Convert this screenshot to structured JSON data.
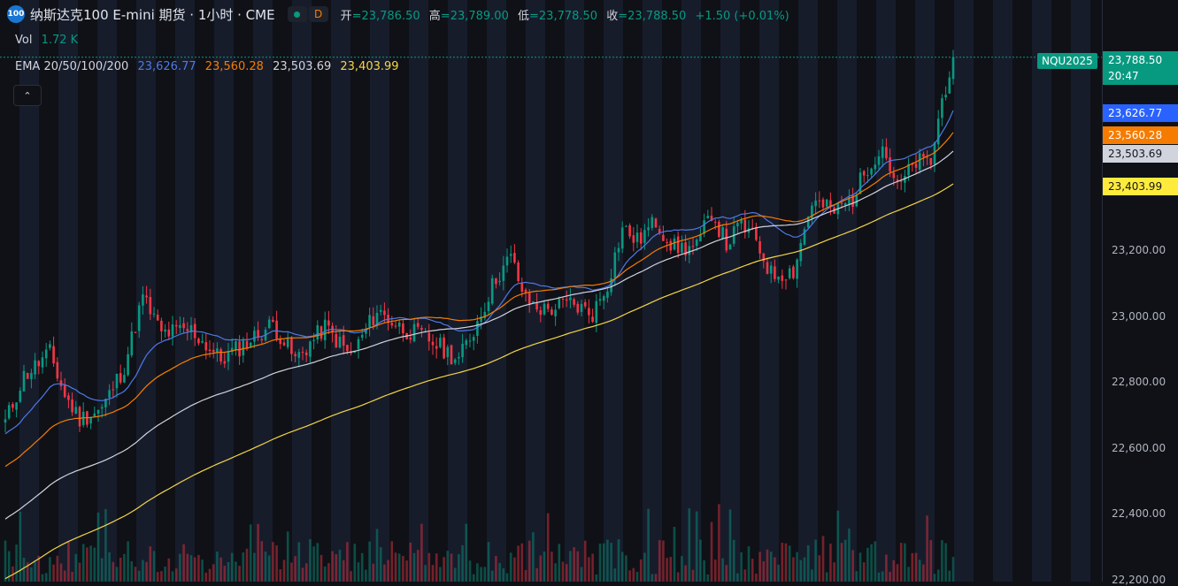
{
  "header": {
    "logo_text": "100",
    "title": "纳斯达克100 E-mini 期货 · 1小时 · CME",
    "interval_button": "D",
    "ohlc": [
      {
        "label": "开",
        "value": "=23,786.50"
      },
      {
        "label": "高",
        "value": "=23,789.00"
      },
      {
        "label": "低",
        "value": "=23,778.50"
      },
      {
        "label": "收",
        "value": "=23,788.50"
      },
      {
        "label": "",
        "value": "+1.50 (+0.01%)"
      }
    ]
  },
  "volume": {
    "label": "Vol",
    "value": "1.72 K"
  },
  "ema": {
    "label": "EMA 20/50/100/200",
    "values": [
      "23,626.77",
      "23,560.28",
      "23,503.69",
      "23,403.99"
    ],
    "colors": [
      "#4e79e6",
      "#f57c00",
      "#d1d4dc",
      "#f5d547"
    ]
  },
  "colors": {
    "up": "#089981",
    "down": "#f23645",
    "background": "#0f1117",
    "band": "#171c2b"
  },
  "symbol_tag": "NQU2025",
  "price_scale": {
    "current_price": "23,788.50",
    "countdown": "20:47",
    "tags": [
      {
        "text": "23,626.77",
        "bg": "#2962ff",
        "fg": "#ffffff"
      },
      {
        "text": "23,560.28",
        "bg": "#f57c00",
        "fg": "#ffffff"
      },
      {
        "text": "23,503.69",
        "bg": "#d1d4dc",
        "fg": "#131722"
      },
      {
        "text": "23,403.99",
        "bg": "#ffeb3b",
        "fg": "#131722"
      }
    ],
    "ticks": [
      "23,200.00",
      "23,000.00",
      "22,800.00",
      "22,600.00",
      "22,400.00",
      "22,200.00"
    ]
  },
  "chart_data": {
    "type": "candlestick",
    "ylim": [
      22200,
      23800
    ],
    "ticks": [
      23200,
      23000,
      22800,
      22600,
      22400,
      22200
    ],
    "close_anchors": [
      [
        0,
        22680
      ],
      [
        5,
        22820
      ],
      [
        12,
        22890
      ],
      [
        16,
        22760
      ],
      [
        20,
        22690
      ],
      [
        26,
        22720
      ],
      [
        32,
        22850
      ],
      [
        37,
        23060
      ],
      [
        42,
        22950
      ],
      [
        50,
        22960
      ],
      [
        58,
        22870
      ],
      [
        66,
        22930
      ],
      [
        72,
        22980
      ],
      [
        78,
        22870
      ],
      [
        86,
        22970
      ],
      [
        93,
        22880
      ],
      [
        100,
        23020
      ],
      [
        106,
        22970
      ],
      [
        114,
        22930
      ],
      [
        122,
        22870
      ],
      [
        126,
        22960
      ],
      [
        132,
        23120
      ],
      [
        136,
        23180
      ],
      [
        140,
        23050
      ],
      [
        145,
        23020
      ],
      [
        152,
        23040
      ],
      [
        158,
        23010
      ],
      [
        162,
        23100
      ],
      [
        166,
        23270
      ],
      [
        170,
        23230
      ],
      [
        175,
        23290
      ],
      [
        180,
        23210
      ],
      [
        186,
        23210
      ],
      [
        190,
        23320
      ],
      [
        194,
        23220
      ],
      [
        198,
        23280
      ],
      [
        202,
        23230
      ],
      [
        206,
        23130
      ],
      [
        212,
        23140
      ],
      [
        217,
        23350
      ],
      [
        223,
        23320
      ],
      [
        228,
        23360
      ],
      [
        232,
        23460
      ],
      [
        236,
        23520
      ],
      [
        240,
        23390
      ],
      [
        245,
        23470
      ],
      [
        249,
        23470
      ],
      [
        252,
        23660
      ],
      [
        255,
        23788.5
      ]
    ],
    "current_close": 23788.5
  }
}
